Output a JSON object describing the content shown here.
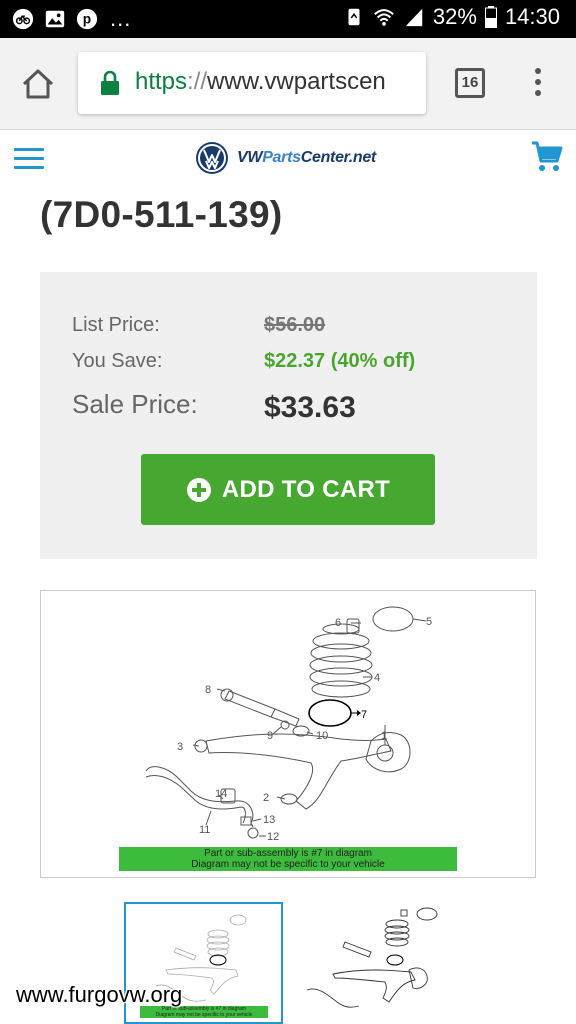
{
  "status_bar": {
    "left_icons": [
      "bike-icon",
      "image-icon",
      "pinterest-icon"
    ],
    "ellipsis": "...",
    "battery": "32%",
    "time": "14:30"
  },
  "browser": {
    "url_scheme": "https",
    "url_separator": "://",
    "url_host": "www.vwpartscen",
    "tab_count": "16"
  },
  "site": {
    "logo_bold": "VW",
    "logo_light": "Parts",
    "logo_rest": "Center.net"
  },
  "product": {
    "part_number": "(7D0-511-139)",
    "list_price_label": "List Price:",
    "list_price": "$56.00",
    "you_save_label": "You Save:",
    "you_save": "$22.37 (40% off)",
    "sale_price_label": "Sale Price:",
    "sale_price": "$33.63",
    "add_to_cart": "ADD TO CART"
  },
  "diagram": {
    "banner_line1": "Part or sub-assembly is #7 in diagram",
    "banner_line2": "Diagram may not be specific to your vehicle",
    "callouts": [
      "1",
      "2",
      "3",
      "4",
      "5",
      "6",
      "7",
      "8",
      "9",
      "10",
      "11",
      "12",
      "13",
      "14"
    ]
  },
  "watermark": "www.furgovw.org",
  "colors": {
    "accent_blue": "#2196d3",
    "green": "#46a830",
    "save_green": "#4aa52e"
  }
}
